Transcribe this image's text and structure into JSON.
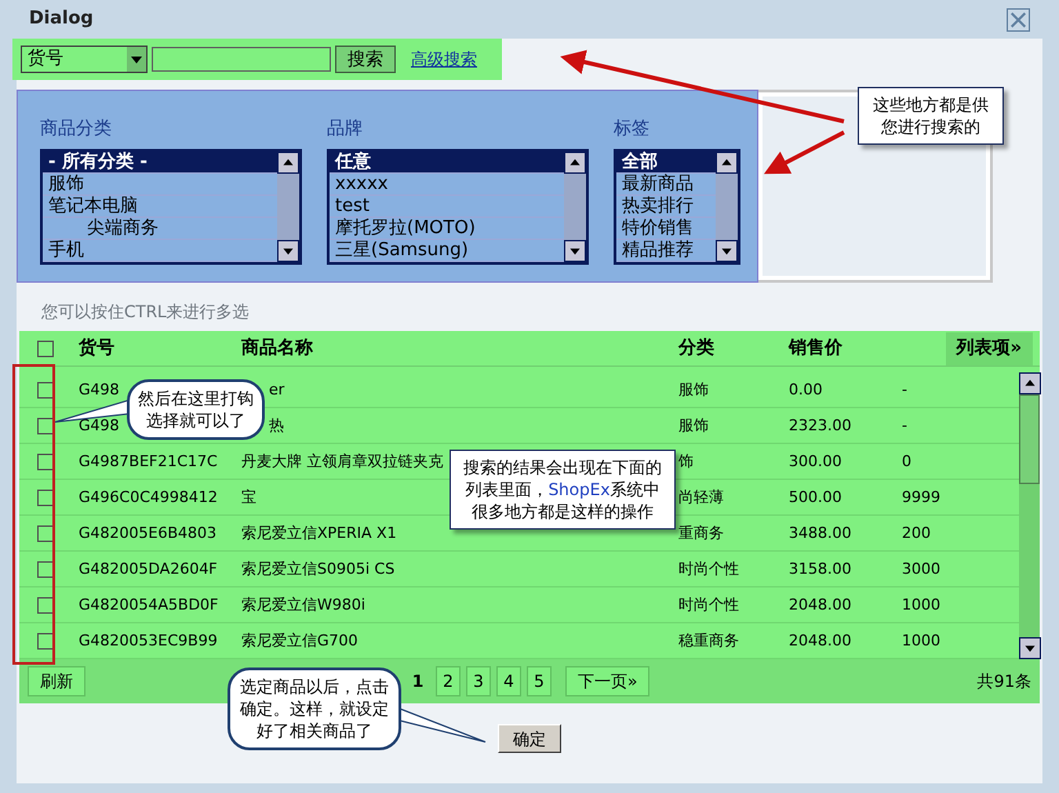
{
  "window": {
    "title": "Dialog"
  },
  "search": {
    "field_select": "货号",
    "button": "搜索",
    "advanced_link": "高级搜索"
  },
  "filters": [
    {
      "label": "商品分类",
      "items": [
        {
          "text": "- 所有分类 -",
          "selected": true
        },
        {
          "text": "服饰",
          "selected": false
        },
        {
          "text": "笔记本电脑",
          "selected": false,
          "children": [
            {
              "text": "尖端商务",
              "selected": false
            }
          ]
        },
        {
          "text": "手机",
          "selected": false
        }
      ]
    },
    {
      "label": "品牌",
      "items": [
        {
          "text": "任意",
          "selected": true
        },
        {
          "text": "xxxxx",
          "selected": false
        },
        {
          "text": "test",
          "selected": false
        },
        {
          "text": "摩托罗拉(MOTO)",
          "selected": false
        },
        {
          "text": "三星(Samsung)",
          "selected": false
        }
      ]
    },
    {
      "label": "标签",
      "items": [
        {
          "text": "全部",
          "selected": true
        },
        {
          "text": "最新商品",
          "selected": false
        },
        {
          "text": "热卖排行",
          "selected": false
        },
        {
          "text": "特价销售",
          "selected": false
        },
        {
          "text": "精品推荐",
          "selected": false
        }
      ]
    }
  ],
  "hint": "您可以按住CTRL来进行多选",
  "table": {
    "columns": [
      "货号",
      "商品名称",
      "分类",
      "销售价"
    ],
    "column_menu": "列表项»",
    "all_checked": false,
    "rows": [
      {
        "checked": false,
        "cells": [
          "G498",
          "er",
          "服饰",
          "0.00",
          "-"
        ]
      },
      {
        "checked": false,
        "cells": [
          "G498",
          "热",
          "服饰",
          "2323.00",
          "-"
        ]
      },
      {
        "checked": false,
        "cells": [
          "G4987BEF21C17C",
          "丹麦大牌 立领肩章双拉链夹克",
          "饰",
          "300.00",
          "0"
        ]
      },
      {
        "checked": false,
        "cells": [
          "G496C0C4998412",
          "宝",
          "尚轻薄",
          "500.00",
          "9999"
        ]
      },
      {
        "checked": false,
        "cells": [
          "G482005E6B4803",
          "索尼爱立信XPERIA X1",
          "重商务",
          "3488.00",
          "200"
        ]
      },
      {
        "checked": false,
        "cells": [
          "G482005DA2604F",
          "索尼爱立信S0905i CS",
          "时尚个性",
          "3158.00",
          "3000"
        ]
      },
      {
        "checked": false,
        "cells": [
          "G4820054A5BD0F",
          "索尼爱立信W980i",
          "时尚个性",
          "2048.00",
          "1000"
        ]
      },
      {
        "checked": false,
        "cells": [
          "G4820053EC9B99",
          "索尼爱立信G700",
          "稳重商务",
          "2048.00",
          "1000"
        ]
      }
    ]
  },
  "footer": {
    "refresh": "刷新",
    "pages": [
      {
        "label": "1",
        "selected": true
      },
      {
        "label": "2",
        "selected": false
      },
      {
        "label": "3",
        "selected": false
      },
      {
        "label": "4",
        "selected": false
      },
      {
        "label": "5",
        "selected": false
      }
    ],
    "next": "下一页»",
    "total": "共91条"
  },
  "confirm": "确定",
  "callouts": [
    {
      "kind": "box",
      "segments": [
        {
          "text": "这些地方都是供您进行搜索的",
          "highlight": false
        }
      ]
    },
    {
      "kind": "bubble",
      "segments": [
        {
          "text": "然后在这里打钩选择就可以了",
          "highlight": false
        }
      ]
    },
    {
      "kind": "box",
      "segments": [
        {
          "text": "搜索的结果会出现在下面的列表里面，",
          "highlight": false
        },
        {
          "text": "ShopEx",
          "highlight": true
        },
        {
          "text": "系统中很多地方都是这样的操作",
          "highlight": false
        }
      ]
    },
    {
      "kind": "bubble",
      "segments": [
        {
          "text": "选定商品以后，点击确定。这样，就设定好了相关商品了",
          "highlight": false
        }
      ]
    }
  ]
}
